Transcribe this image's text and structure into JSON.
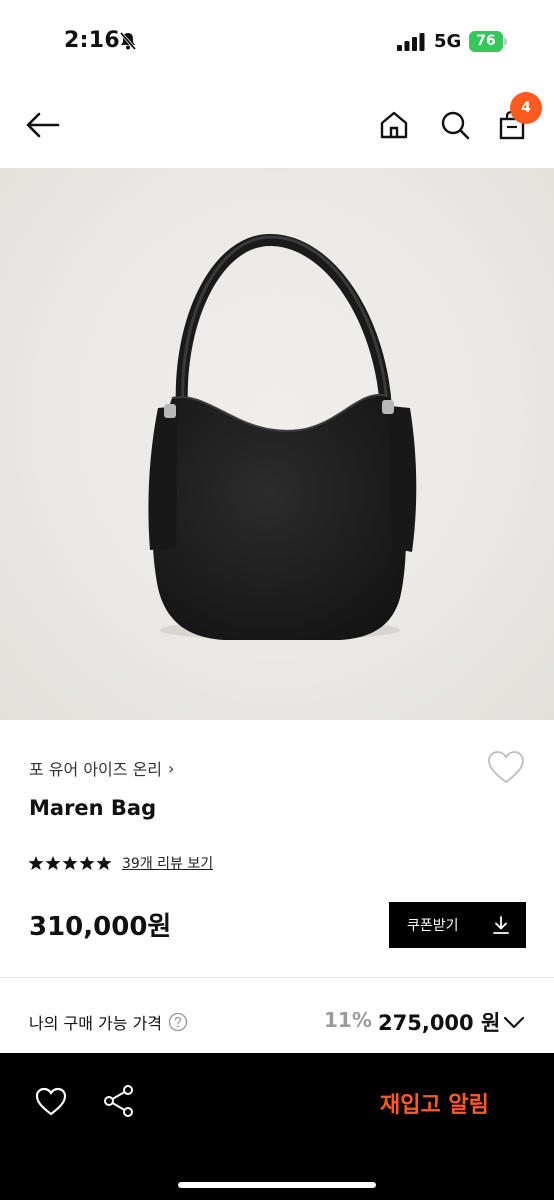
{
  "status_bar": {
    "time": "2:16",
    "network": "5G",
    "battery": "76"
  },
  "nav": {
    "back_icon": "arrow-left-icon",
    "home_icon": "home-icon",
    "search_icon": "search-icon",
    "cart_icon": "shopping-bag-icon",
    "cart_count": "4"
  },
  "colors": {
    "accent": "#ff5a1f",
    "battery": "#34c759",
    "bottom_bar": "#000000"
  },
  "product": {
    "brand": "포 유어 아이즈 온리",
    "brand_chevron": "›",
    "name": "Maren Bag",
    "rating_stars": 5,
    "review_link": "39개 리뷰 보기",
    "price": "310,000원",
    "coupon_label": "쿠폰받기"
  },
  "buyable": {
    "label": "나의 구매 가능 가격",
    "discount": "11%",
    "price": "275,000 원"
  },
  "bottom_bar": {
    "restock_label": "재입고 알림",
    "wish_icon": "heart-outline-icon",
    "share_icon": "share-icon"
  }
}
